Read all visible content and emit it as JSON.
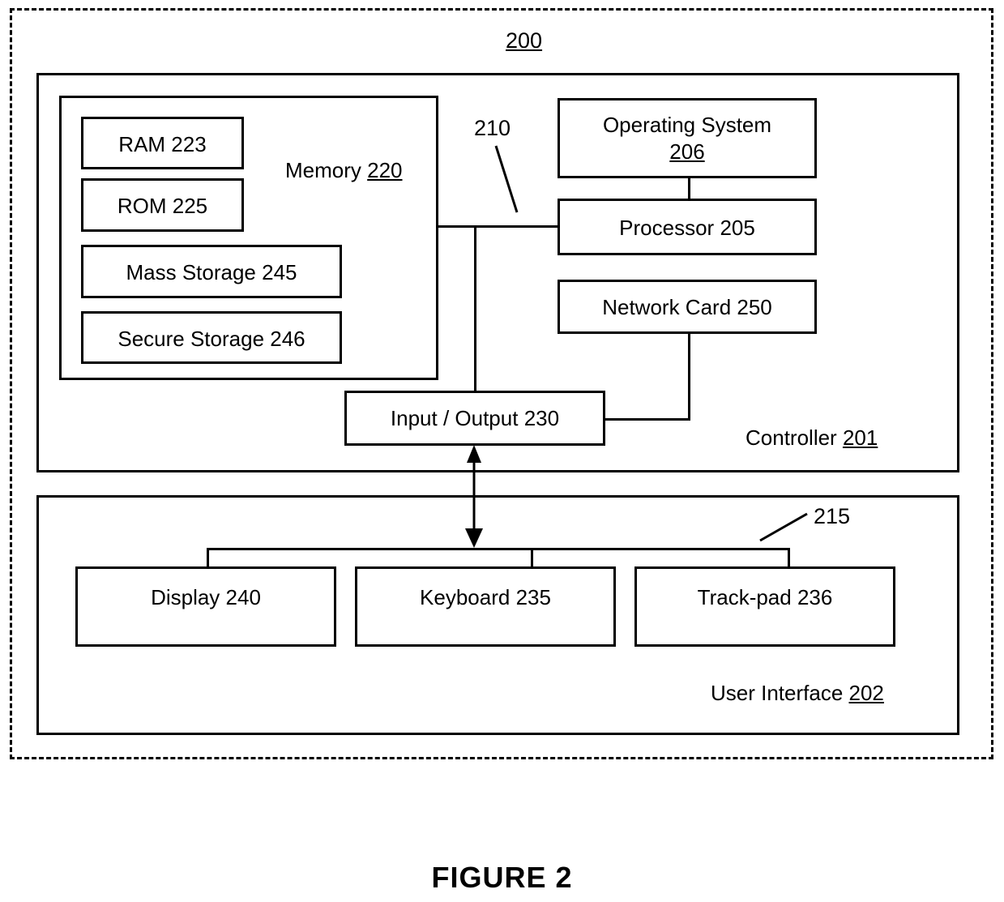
{
  "figure": {
    "caption": "FIGURE 2",
    "system_ref": "200"
  },
  "reference_numerals": {
    "system": "200",
    "controller_bus": "210",
    "ui_bus": "215"
  },
  "controller": {
    "label_text": "Controller ",
    "label_num": "201",
    "memory": {
      "label_text": "Memory ",
      "label_num": "220",
      "items": [
        {
          "text": "RAM ",
          "num": "223"
        },
        {
          "text": "ROM ",
          "num": "225"
        },
        {
          "text": "Mass Storage ",
          "num": "245"
        },
        {
          "text": "Secure Storage ",
          "num": "246"
        }
      ]
    },
    "operating_system": {
      "line1": "Operating System",
      "line2": "206"
    },
    "processor": {
      "text": "Processor ",
      "num": "205"
    },
    "network_card": {
      "text": "Network Card ",
      "num": "250"
    },
    "input_output": {
      "text": "Input / Output ",
      "num": "230"
    }
  },
  "user_interface": {
    "label_text": "User Interface ",
    "label_num": "202",
    "devices": [
      {
        "text": "Display  ",
        "num": "240"
      },
      {
        "text": "Keyboard ",
        "num": "235"
      },
      {
        "text": "Track-pad ",
        "num": "236"
      }
    ]
  },
  "colors": {
    "stroke": "#000000",
    "background": "#ffffff"
  }
}
